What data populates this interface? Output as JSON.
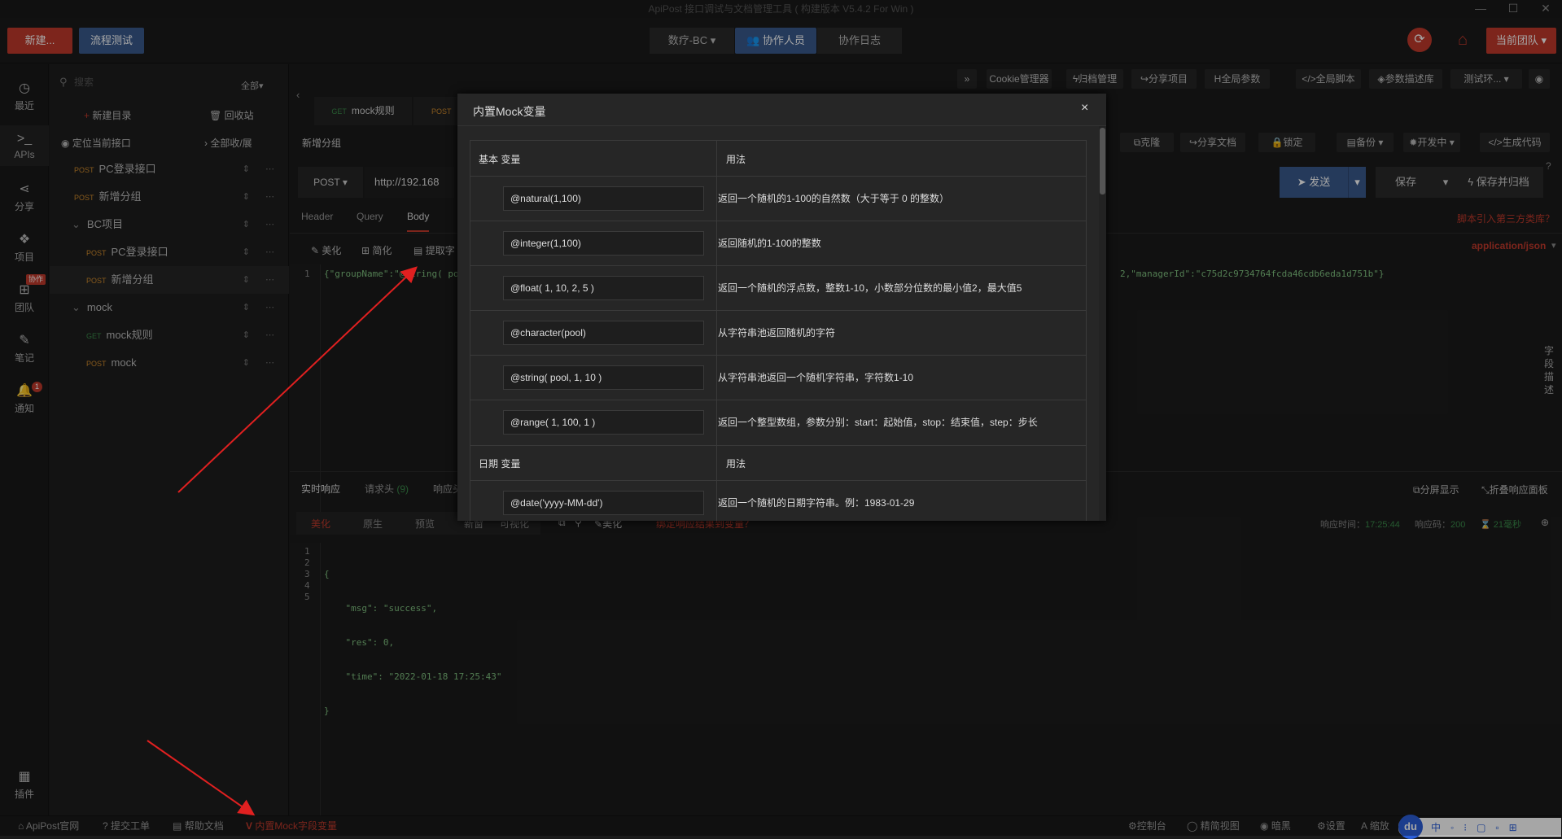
{
  "titlebar": {
    "title": "ApiPost 接口调试与文档管理工具 ( 构建版本 V5.4.2 For Win )"
  },
  "topbar": {
    "new_label": "新建...",
    "flow_label": "流程测试",
    "project_select": "数疗-BC",
    "collaborators_label": "协作人员",
    "log_label": "协作日志",
    "team_label": "当前团队"
  },
  "leftnav": {
    "recent": "最近",
    "apis": "APIs",
    "share": "分享",
    "project": "项目",
    "team": "团队",
    "team_badge": "协作",
    "notes": "笔记",
    "notify": "通知",
    "notify_count": "1",
    "plugins": "插件"
  },
  "sidebar": {
    "search_placeholder": "搜索",
    "filter": "全部",
    "new_dir": "新建目录",
    "recycle": "回收站",
    "locate": "定位当前接口",
    "expand": "全部收/展",
    "items": [
      {
        "method": "POST",
        "label": "PC登录接口"
      },
      {
        "method": "POST",
        "label": "新增分组"
      },
      {
        "folder": "BC项目"
      },
      {
        "method": "POST",
        "label": "PC登录接口"
      },
      {
        "method": "POST",
        "label": "新增分组"
      },
      {
        "folder": "mock"
      },
      {
        "method": "GET",
        "label": "mock规则"
      },
      {
        "method": "POST",
        "label": "mock"
      }
    ]
  },
  "main": {
    "toolbar": {
      "cookie": "Cookie管理器",
      "archive": "归档管理",
      "share_project": "分享项目",
      "global_params": "全局参数",
      "global_script": "全局脚本",
      "param_desc": "参数描述库",
      "env": "测试环..."
    },
    "tabs": [
      {
        "method": "GET",
        "label": "mock规则"
      },
      {
        "method": "POST",
        "label": ""
      }
    ],
    "group_title": "新增分组",
    "actions": {
      "clone": "克隆",
      "share_doc": "分享文档",
      "lock": "锁定",
      "backup": "备份",
      "dev": "开发中",
      "gen_code": "生成代码"
    },
    "request": {
      "method": "POST",
      "url": "http://192.168",
      "send": "发送",
      "save": "保存",
      "save_archive": "保存并归档"
    },
    "req_tabs": {
      "header": "Header",
      "query": "Query",
      "body": "Body"
    },
    "script_link": "脚本引入第三方类库？",
    "body_tools": {
      "beautify": "美化",
      "simplify": "简化",
      "extract": "提取字"
    },
    "content_type": "application/json",
    "body_line_no": "1",
    "body_code_left": "{\"groupName\":\"@string( po",
    "body_code_right": "2,\"managerId\":\"c75d2c9734764fcda46cdb6eda1d751b\"}",
    "field_desc": [
      "字",
      "段",
      "描",
      "述"
    ],
    "response": {
      "tabs": {
        "realtime": "实时响应",
        "headers": "请求头",
        "headers_count": "(9)",
        "resp_trunc": "响应头"
      },
      "split": "分屏显示",
      "fold": "折叠响应面板",
      "sub_tabs": [
        "美化",
        "原生",
        "预览",
        "新窗",
        "可视化"
      ],
      "beautify": "美化",
      "bind_var": "绑定响应结果到变量？",
      "time_label": "响应时间：",
      "time_value": "17:25:44",
      "code_label": "响应码：",
      "code_value": "200",
      "duration": "21毫秒",
      "line_numbers": [
        "1",
        "2",
        "3",
        "4",
        "5"
      ],
      "lines": [
        "{",
        "    \"msg\": \"success\",",
        "    \"res\": 0,",
        "    \"time\": \"2022-01-18 17:25:43\"",
        "}"
      ]
    }
  },
  "modal": {
    "title": "内置Mock变量",
    "close": "×",
    "basic_header": {
      "col1": "基本 变量",
      "col2": "用法"
    },
    "basic_rows": [
      {
        "var": "@natural(1,100)",
        "desc": "返回一个随机的1-100的自然数（大于等于 0 的整数）"
      },
      {
        "var": "@integer(1,100)",
        "desc": "返回随机的1-100的整数"
      },
      {
        "var": "@float( 1, 10, 2, 5 )",
        "desc": "返回一个随机的浮点数，整数1-10，小数部分位数的最小值2，最大值5"
      },
      {
        "var": "@character(pool)",
        "desc": "从字符串池返回随机的字符"
      },
      {
        "var": "@string( pool, 1, 10 )",
        "desc": "从字符串池返回一个随机字符串，字符数1-10"
      },
      {
        "var": "@range( 1, 100, 1 )",
        "desc": "返回一个整型数组，参数分别：start：起始值，stop：结束值，step：步长"
      }
    ],
    "date_header": {
      "col1": "日期 变量",
      "col2": "用法"
    },
    "date_rows": [
      {
        "var": "@date('yyyy-MM-dd')",
        "desc": "返回一个随机的日期字符串。例：1983-01-29"
      }
    ]
  },
  "statusbar": {
    "official": "ApiPost官网",
    "ticket": "提交工单",
    "help": "帮助文档",
    "mock_vars": "内置Mock字段变量",
    "console": "控制台",
    "simple_view": "精简视图",
    "dark": "暗黑",
    "settings": "设置",
    "zoom": "缩放"
  },
  "colors": {
    "accent_red": "#c0392b",
    "accent_blue": "#3a5a8c",
    "post": "#d08a2c",
    "get": "#3a8a4a",
    "arrow": "#e02020"
  }
}
